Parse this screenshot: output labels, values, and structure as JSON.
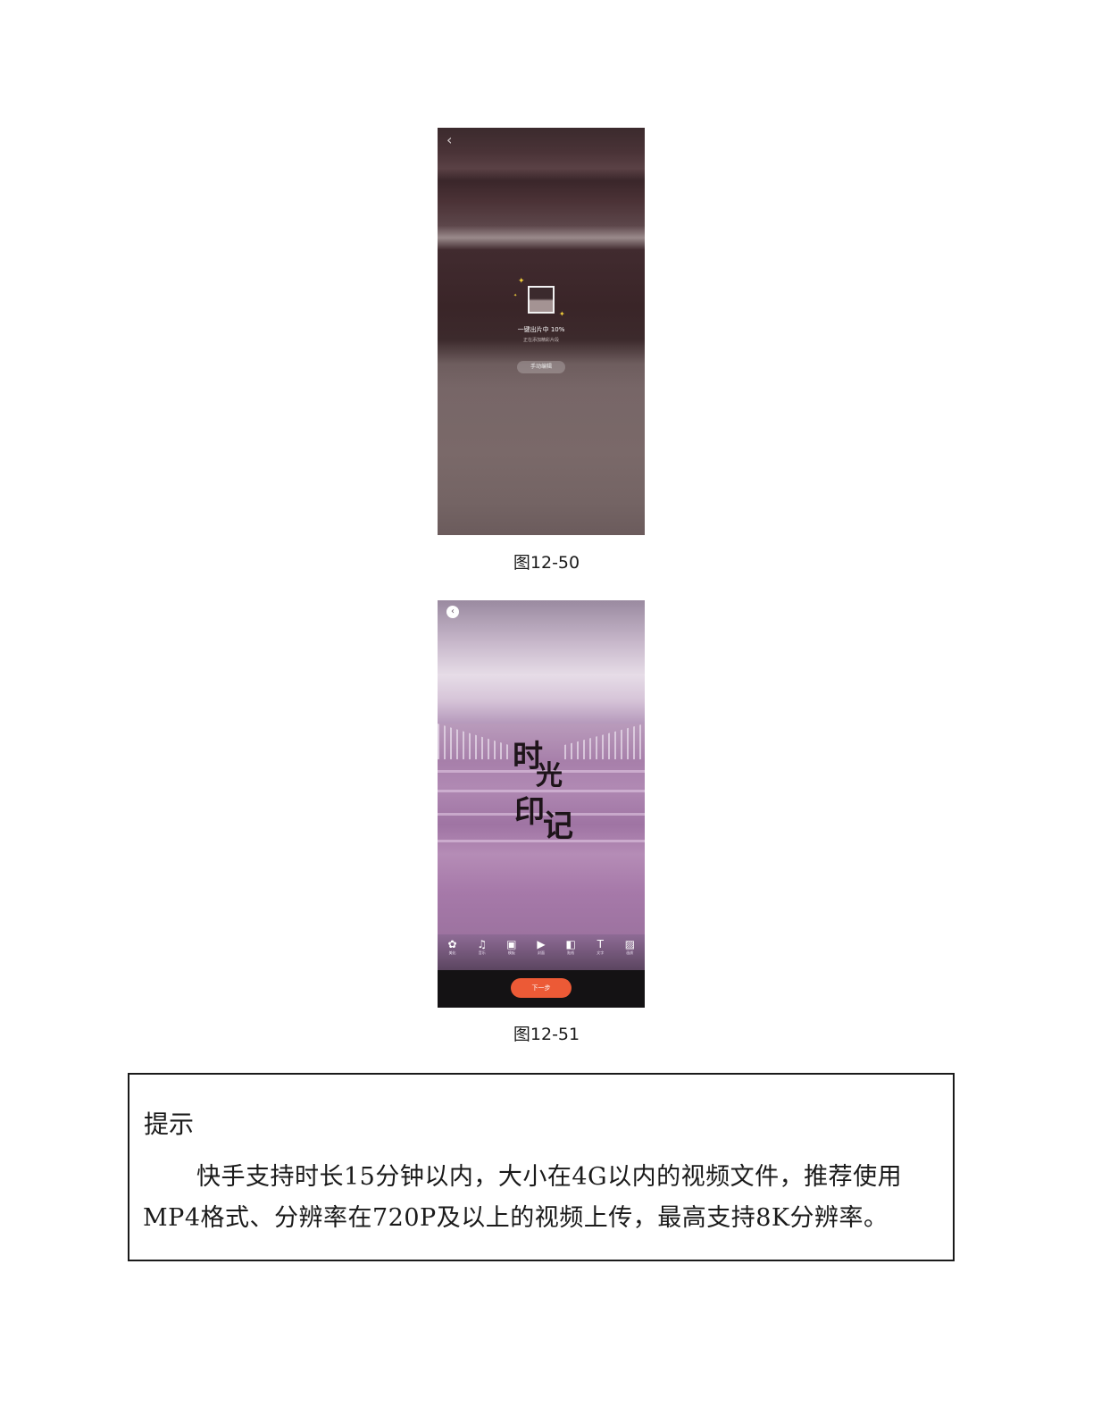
{
  "figure1": {
    "caption": "图12-50",
    "back_icon": "‹",
    "progress_title": "一键出片中 10%",
    "progress_subtitle": "正在添加精彩片段",
    "manual_button": "手动编辑"
  },
  "figure2": {
    "caption": "图12-51",
    "back_icon": "‹",
    "title_chars": [
      "时",
      "光",
      "印",
      "记"
    ],
    "tools": [
      {
        "icon": "filter-icon",
        "glyph": "✿",
        "label": "美化"
      },
      {
        "icon": "music-icon",
        "glyph": "♫",
        "label": "音乐"
      },
      {
        "icon": "template-icon",
        "glyph": "▣",
        "label": "模板"
      },
      {
        "icon": "play-icon",
        "glyph": "▶",
        "label": "封面"
      },
      {
        "icon": "sticker-icon",
        "glyph": "◧",
        "label": "贴纸"
      },
      {
        "icon": "text-icon",
        "glyph": "T",
        "label": "文字"
      },
      {
        "icon": "image-icon",
        "glyph": "▨",
        "label": "画质"
      }
    ],
    "next_button": "下一步"
  },
  "tip": {
    "title": "提示",
    "body": "快手支持时长15分钟以内，大小在4G以内的视频文件，推荐使用MP4格式、分辨率在720P及以上的视频上传，最高支持8K分辨率。"
  }
}
